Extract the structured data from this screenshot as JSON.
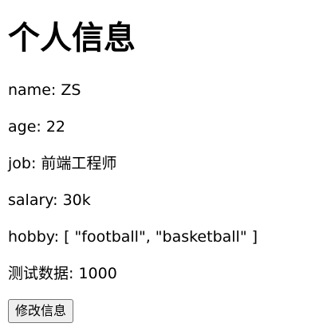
{
  "page": {
    "title": "个人信息"
  },
  "info": {
    "name_label": "name:",
    "name_value": "ZS",
    "age_label": "age:",
    "age_value": "22",
    "job_label": "job:",
    "job_value": "前端工程师",
    "salary_label": "salary:",
    "salary_value": "30k",
    "hobby_label": "hobby:",
    "hobby_value": "[ \"football\", \"basketball\" ]",
    "test_label": "测试数据:",
    "test_value": "1000"
  },
  "actions": {
    "edit_label": "修改信息"
  }
}
